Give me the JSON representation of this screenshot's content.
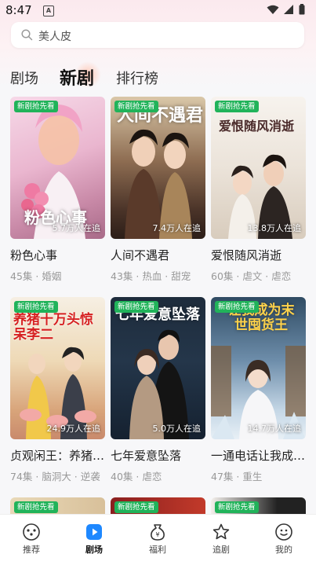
{
  "status": {
    "time": "8:47",
    "a_icon": "A"
  },
  "search": {
    "placeholder": "美人皮"
  },
  "tabs": [
    {
      "label": "剧场"
    },
    {
      "label": "新剧",
      "active": true
    },
    {
      "label": "排行榜"
    }
  ],
  "cards": [
    {
      "badge": "新剧抢先看",
      "watching": "5.7万人在追",
      "title": "粉色心事",
      "meta": "45集 · 婚姻",
      "poster_title": "粉色心事"
    },
    {
      "badge": "新剧抢先看",
      "watching": "7.4万人在追",
      "title": "人间不遇君",
      "meta": "43集 · 热血 · 甜宠",
      "poster_title": "人间不遇君"
    },
    {
      "badge": "新剧抢先看",
      "watching": "13.8万人在追",
      "title": "爱恨随风消逝",
      "meta": "60集 · 虐文 · 虐恋",
      "poster_title": "爱恨随风消逝"
    },
    {
      "badge": "新剧抢先看",
      "watching": "24.9万人在追",
      "title": "贞观闲王：养猪…",
      "meta": "74集 · 脑洞大 · 逆袭",
      "poster_title": "养猪十万头惊呆李二"
    },
    {
      "badge": "新剧抢先看",
      "watching": "5.0万人在追",
      "title": "七年爱意坠落",
      "meta": "40集 · 虐恋",
      "poster_title": "七年爱意坠落"
    },
    {
      "badge": "新剧抢先看",
      "watching": "14.7万人在追",
      "title": "一通电话让我成…",
      "meta": "47集 · 重生",
      "poster_title": "让我成为末世囤货王"
    },
    {
      "badge": "新剧抢先看"
    },
    {
      "badge": "新剧抢先看"
    },
    {
      "badge": "新剧抢先看"
    }
  ],
  "nav": [
    {
      "label": "推荐",
      "icon": "recommend-icon"
    },
    {
      "label": "剧场",
      "icon": "play-icon",
      "active": true
    },
    {
      "label": "福利",
      "icon": "money-bag-icon"
    },
    {
      "label": "追剧",
      "icon": "star-icon"
    },
    {
      "label": "我的",
      "icon": "smiley-icon"
    }
  ],
  "colors": {
    "accent": "#21b35a",
    "badge": "#21b35a",
    "active_nav": "#1e88ff"
  }
}
